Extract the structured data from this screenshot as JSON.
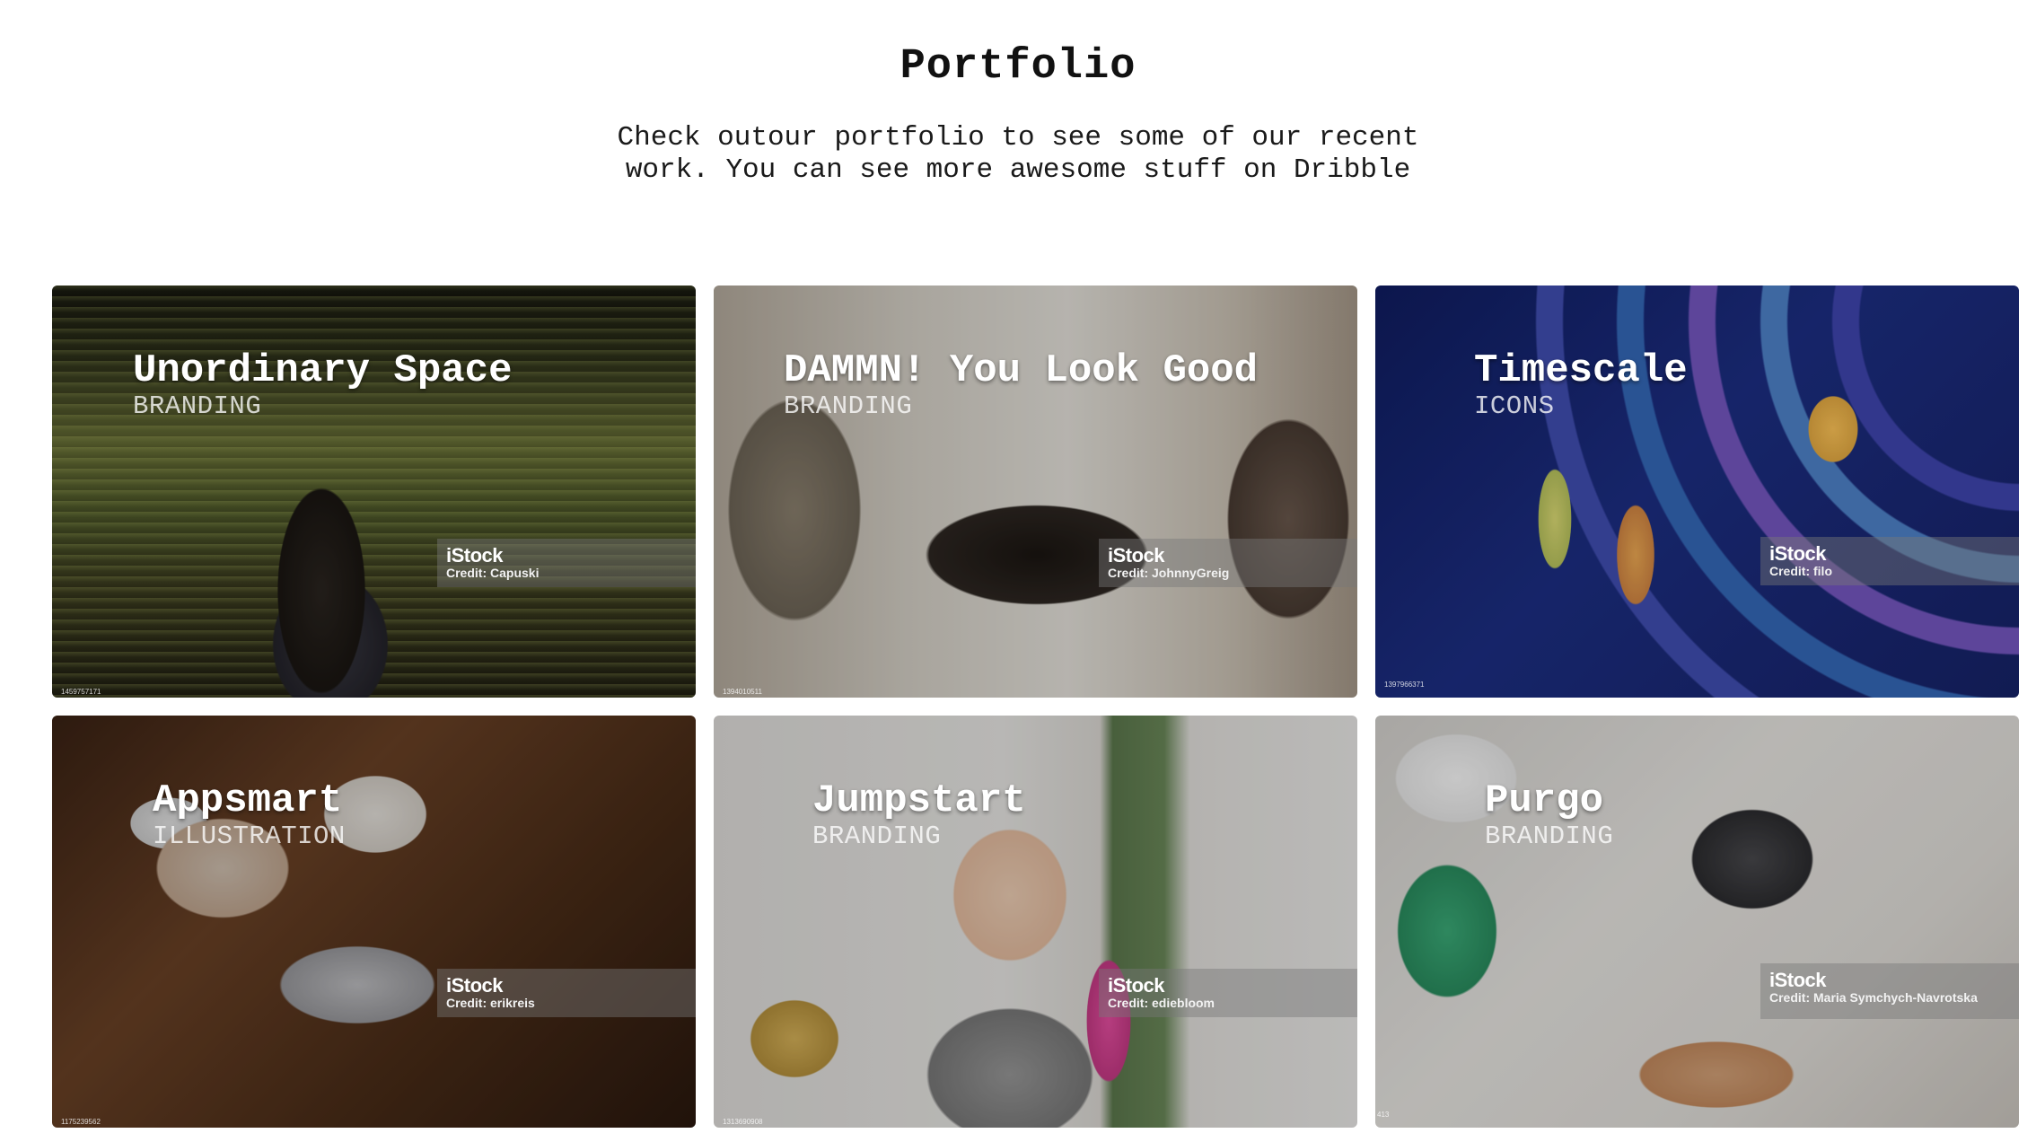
{
  "header": {
    "title": "Portfolio",
    "subtitle": "Check outour portfolio to see some of our recent work. You can see more awesome stuff on Dribble"
  },
  "cards": [
    {
      "title": "Unordinary Space",
      "category": "BRANDING",
      "watermark_brand": "iStock",
      "watermark_credit": "Credit: Capuski",
      "image_id": "1459757171"
    },
    {
      "title": "DAMMN! You Look Good",
      "category": "BRANDING",
      "watermark_brand": "iStock",
      "watermark_credit": "Credit: JohnnyGreig",
      "image_id": "1394010511"
    },
    {
      "title": "Timescale",
      "category": "ICONS",
      "watermark_brand": "iStock",
      "watermark_credit": "Credit: filo",
      "image_id": "1397966371"
    },
    {
      "title": "Appsmart",
      "category": "ILLUSTRATION",
      "watermark_brand": "iStock",
      "watermark_credit": "Credit: erikreis",
      "image_id": "1175239562"
    },
    {
      "title": "Jumpstart",
      "category": "BRANDING",
      "watermark_brand": "iStock",
      "watermark_credit": "Credit: ediebloom",
      "image_id": "1313690908"
    },
    {
      "title": "Purgo",
      "category": "BRANDING",
      "watermark_brand": "iStock",
      "watermark_credit": "Credit: Maria Symchych-Navrotska",
      "image_id": "413"
    }
  ]
}
